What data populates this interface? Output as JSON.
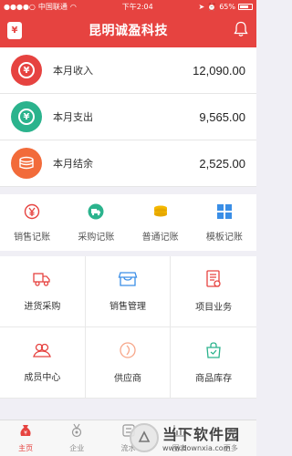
{
  "status": {
    "carrier": "中国联通",
    "time": "下午2:04",
    "battery": "65%",
    "battery_level": 0.65
  },
  "header": {
    "title": "昆明诚盈科技"
  },
  "summary": [
    {
      "label": "本月收入",
      "value": "12,090.00",
      "color": "#e64340",
      "icon": "yen-icon"
    },
    {
      "label": "本月支出",
      "value": "9,565.00",
      "color": "#2bb38d",
      "icon": "yen-icon"
    },
    {
      "label": "本月结余",
      "value": "2,525.00",
      "color": "#f26b3a",
      "icon": "coins-icon"
    }
  ],
  "quick_actions": [
    {
      "label": "销售记账",
      "icon": "yen-outline-icon"
    },
    {
      "label": "采购记账",
      "icon": "truck-icon"
    },
    {
      "label": "普通记账",
      "icon": "coin-stack-icon"
    },
    {
      "label": "模板记账",
      "icon": "grid-icon"
    }
  ],
  "modules": [
    {
      "label": "进货采购",
      "icon": "truck-outline-icon"
    },
    {
      "label": "销售管理",
      "icon": "shop-icon"
    },
    {
      "label": "项目业务",
      "icon": "document-icon"
    },
    {
      "label": "成员中心",
      "icon": "members-icon"
    },
    {
      "label": "供应商",
      "icon": "supplier-icon"
    },
    {
      "label": "商品库存",
      "icon": "bag-icon"
    }
  ],
  "tabs": [
    {
      "label": "主页",
      "icon": "money-bag-icon"
    },
    {
      "label": "企业",
      "icon": "medal-icon"
    },
    {
      "label": "流水",
      "icon": "flow-icon"
    },
    {
      "label": "图表",
      "icon": "chart-icon"
    },
    {
      "label": "更多",
      "icon": "more-icon"
    }
  ],
  "watermark": {
    "name": "当下软件园",
    "url": "www.downxia.com"
  },
  "colors": {
    "primary": "#e64340",
    "green": "#2bb38d",
    "orange": "#f26b3a",
    "blue": "#3a8ee6",
    "gold": "#f5b800"
  }
}
